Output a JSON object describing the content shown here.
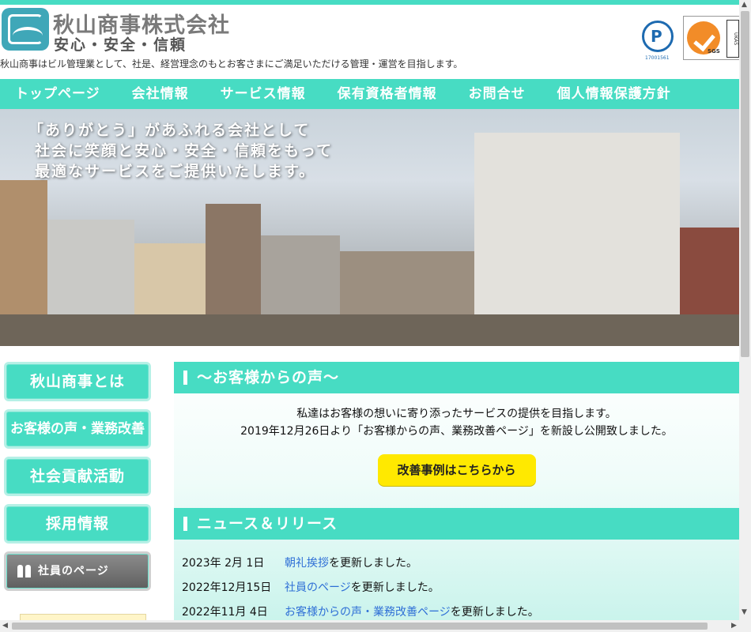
{
  "header": {
    "company_name": "秋山商事株式会社",
    "slogan": "安心・安全・信頼",
    "tagline": "秋山商事はビル管理業として、社是、経営理念のもとお客さまにご満足いただける管理・運営を目指します。",
    "privacy_mark_number": "17001561",
    "iso_badge_text": "SGS",
    "ukas_text": "UKAS"
  },
  "nav": {
    "items": [
      {
        "label": "トップページ"
      },
      {
        "label": "会社情報"
      },
      {
        "label": "サービス情報"
      },
      {
        "label": "保有資格者情報"
      },
      {
        "label": "お問合せ"
      },
      {
        "label": "個人情報保護方針"
      }
    ]
  },
  "hero": {
    "line1": "「ありがとう」があふれる会社として",
    "line2": "社会に笑顔と安心・安全・信頼をもって",
    "line3": "最適なサービスをご提供いたします。"
  },
  "sidebar": {
    "items": [
      {
        "label": "秋山商事とは"
      },
      {
        "label": "お客様の声・業務改善"
      },
      {
        "label": "社会貢献活動"
      },
      {
        "label": "採用情報"
      },
      {
        "label": "社員のページ"
      }
    ]
  },
  "voice": {
    "heading": "〜お客様からの声〜",
    "line1": "私達はお客様の想いに寄り添ったサービスの提供を目指します。",
    "line2": "2019年12月26日より「お客様からの声、業務改善ページ」を新設し公開致しました。",
    "cta_label": "改善事例はこちらから"
  },
  "news": {
    "heading": "ニュース＆リリース",
    "items": [
      {
        "date": "2023年 2月 1日",
        "link": "朝礼挨拶",
        "suffix": "を更新しました。"
      },
      {
        "date": "2022年12月15日",
        "link": "社員のページ",
        "suffix": "を更新しました。"
      },
      {
        "date": "2022年11月 4日",
        "link": "お客様からの声・業務改善ページ",
        "suffix": "を更新しました。"
      }
    ]
  },
  "colors": {
    "accent": "#47dcc3",
    "cta": "#ffe900",
    "link": "#2e6fd6"
  }
}
